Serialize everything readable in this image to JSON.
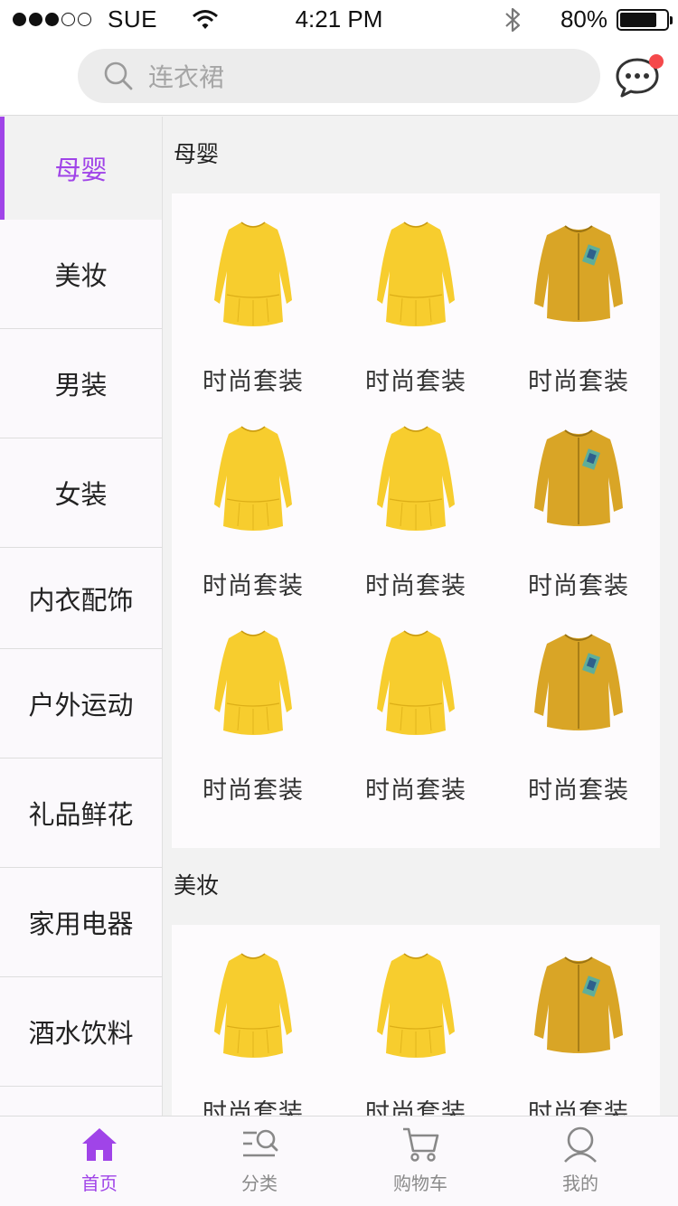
{
  "status_bar": {
    "carrier": "SUE",
    "time": "4:21 PM",
    "battery": "80%",
    "battery_level": 0.8,
    "signal_dots_filled": 3,
    "signal_dots_total": 5
  },
  "search": {
    "placeholder": "连衣裙"
  },
  "sidebar": {
    "items": [
      {
        "label": "母婴",
        "selected": true
      },
      {
        "label": "美妆"
      },
      {
        "label": "男装"
      },
      {
        "label": "女装"
      },
      {
        "label": "内衣配饰"
      },
      {
        "label": "户外运动"
      },
      {
        "label": "礼品鲜花"
      },
      {
        "label": "家用电器"
      },
      {
        "label": "酒水饮料"
      }
    ]
  },
  "sections": [
    {
      "title": "母婴",
      "products": [
        {
          "label": "时尚套装",
          "image": "yellow-dress"
        },
        {
          "label": "时尚套装",
          "image": "yellow-dress"
        },
        {
          "label": "时尚套装",
          "image": "mustard-jacket"
        },
        {
          "label": "时尚套装",
          "image": "yellow-dress"
        },
        {
          "label": "时尚套装",
          "image": "yellow-dress"
        },
        {
          "label": "时尚套装",
          "image": "mustard-jacket"
        },
        {
          "label": "时尚套装",
          "image": "yellow-dress"
        },
        {
          "label": "时尚套装",
          "image": "yellow-dress"
        },
        {
          "label": "时尚套装",
          "image": "mustard-jacket"
        }
      ]
    },
    {
      "title": "美妆",
      "products": [
        {
          "label": "时尚套装",
          "image": "yellow-dress"
        },
        {
          "label": "时尚套装",
          "image": "yellow-dress"
        },
        {
          "label": "时尚套装",
          "image": "mustard-jacket"
        }
      ]
    }
  ],
  "tabbar": {
    "tabs": [
      {
        "label": "首页",
        "icon": "home-icon",
        "active": true
      },
      {
        "label": "分类",
        "icon": "category-search-icon"
      },
      {
        "label": "购物车",
        "icon": "cart-icon"
      },
      {
        "label": "我的",
        "icon": "user-icon"
      }
    ]
  },
  "colors": {
    "accent": "#a044e8",
    "notification": "#f5494b",
    "dress": "#f7cd2e",
    "jacket": "#d9a526"
  }
}
